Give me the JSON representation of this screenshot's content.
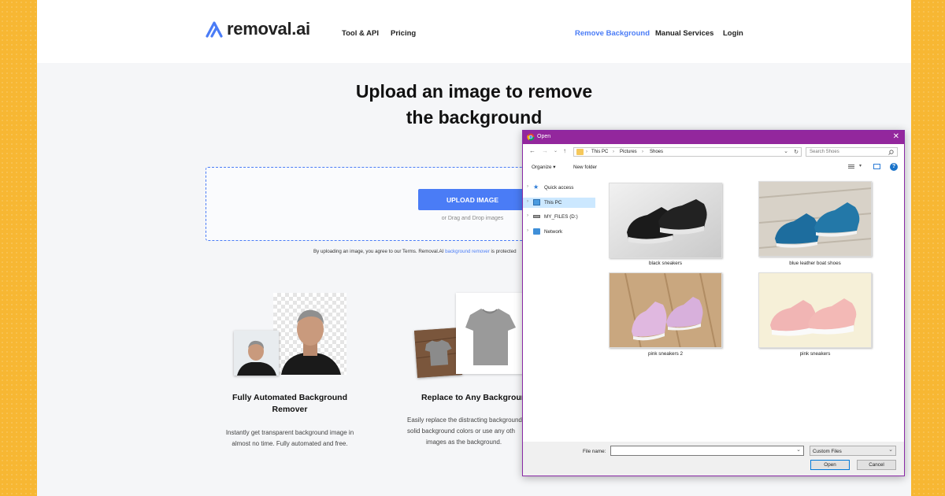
{
  "site": {
    "logo_text": "removal.ai",
    "nav_left": [
      "Tool & API",
      "Pricing"
    ],
    "nav_right": [
      "Remove Background",
      "Manual Services",
      "Login"
    ],
    "active_nav": "Remove Background",
    "hero_line1": "Upload an image to remove",
    "hero_line2": "the background",
    "upload_label": "UPLOAD IMAGE",
    "drag_text": "or Drag and Drop images",
    "terms_text": "By uploading an image, you agree to our Terms. Removal.AI",
    "terms_link": "background remover",
    "terms_tail": "is protected",
    "features": [
      {
        "title_line1": "Fully Automated Background",
        "title_line2": "Remover",
        "desc_line1": "Instantly get transparent background image in",
        "desc_line2": "almost no time. Fully automated and free."
      },
      {
        "title_line1": "Replace to Any Background",
        "desc_line1": "Easily replace the distracting background",
        "desc_line2": "solid background colors or use any oth",
        "desc_line3": "images as the background."
      }
    ],
    "colors": {
      "accent": "#4a7cf6",
      "page_bg": "#f5f6f8",
      "outer_bg": "#f7b733"
    }
  },
  "dialog": {
    "title": "Open",
    "close": "✕",
    "path": [
      "This PC",
      "Pictures",
      "Shoes"
    ],
    "search_placeholder": "Search Shoes",
    "organize": "Organize ▾",
    "new_folder": "New folder",
    "nav_items": [
      {
        "label": "Quick access",
        "icon": "star-icon"
      },
      {
        "label": "This PC",
        "icon": "computer-icon",
        "selected": true
      },
      {
        "label": "MY_FILES (D:)",
        "icon": "drive-icon"
      },
      {
        "label": "Network",
        "icon": "network-icon"
      }
    ],
    "files": [
      "black sneakers",
      "blue leather boat shoes",
      "pink sneakers 2",
      "pink sneakers"
    ],
    "file_name_label": "File name:",
    "file_name_value": "",
    "file_type": "Custom Files",
    "open_label": "Open",
    "cancel_label": "Cancel",
    "accent": "#93279d"
  }
}
